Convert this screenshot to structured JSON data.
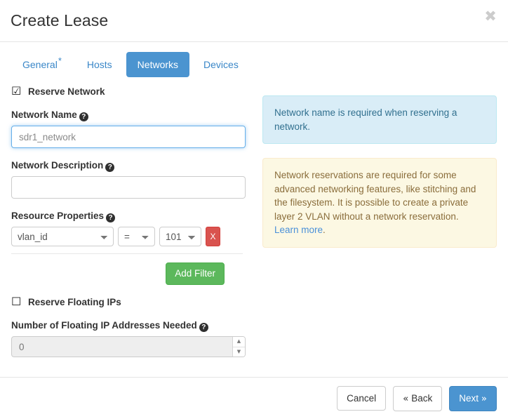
{
  "header": {
    "title": "Create Lease",
    "close_label": "✖"
  },
  "tabs": [
    {
      "label": "General",
      "required_marker": "*",
      "active": false
    },
    {
      "label": "Hosts",
      "required_marker": "",
      "active": false
    },
    {
      "label": "Networks",
      "required_marker": "",
      "active": true
    },
    {
      "label": "Devices",
      "required_marker": "",
      "active": false
    }
  ],
  "form": {
    "reserve_network": {
      "label": "Reserve Network",
      "checked": true,
      "glyph": "☑"
    },
    "network_name": {
      "label": "Network Name",
      "help": "?",
      "value": "",
      "placeholder": "sdr1_network",
      "focused": true
    },
    "network_description": {
      "label": "Network Description",
      "help": "?",
      "value": "",
      "placeholder": ""
    },
    "resource_properties": {
      "label": "Resource Properties",
      "help": "?",
      "filters": [
        {
          "key": "vlan_id",
          "operator": "=",
          "value": "101",
          "remove_label": "X"
        }
      ],
      "add_filter_label": "Add Filter"
    },
    "reserve_floating_ips": {
      "label": "Reserve Floating IPs",
      "checked": false,
      "glyph": "☐"
    },
    "floating_ip_count": {
      "label": "Number of Floating IP Addresses Needed",
      "help": "?",
      "value": "0",
      "disabled": true,
      "spin_up": "▲",
      "spin_down": "▼"
    }
  },
  "alerts": {
    "info": {
      "text": "Network name is required when reserving a network."
    },
    "warning": {
      "text": "Network reservations are required for some advanced networking features, like stitching and the filesystem. It is possible to create a private layer 2 VLAN without a network reservation. ",
      "link_text": "Learn more",
      "link_suffix": "."
    }
  },
  "footer": {
    "cancel_label": "Cancel",
    "back_label": "Back",
    "back_chevron": "«",
    "next_label": "Next",
    "next_chevron": "»"
  },
  "colors": {
    "accent_blue": "#4b94d0",
    "link_blue": "#3a87c8",
    "danger_red": "#d9534f",
    "success_green": "#5cb85c",
    "info_bg": "#d9edf7",
    "warning_bg": "#fcf8e3"
  }
}
